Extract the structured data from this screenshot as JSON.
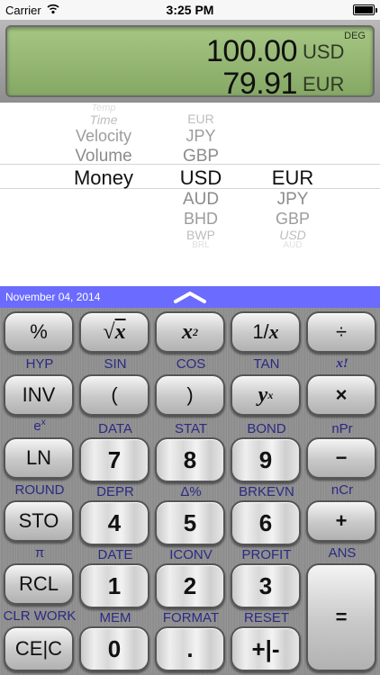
{
  "status_bar": {
    "carrier": "Carrier",
    "time": "3:25 PM"
  },
  "display": {
    "mode": "DEG",
    "line1_value": "100.00",
    "line1_currency": "USD",
    "line2_value": "79.91",
    "line2_currency": "EUR"
  },
  "picker": {
    "category": {
      "above": [
        "Temp",
        "Time",
        "Velocity",
        "Volume"
      ],
      "selected": "Money"
    },
    "from_currency": {
      "above": [
        "EUR",
        "JPY",
        "GBP"
      ],
      "selected": "USD",
      "below": [
        "AUD",
        "BHD",
        "BWP",
        "BRL"
      ]
    },
    "to_currency": {
      "selected": "EUR",
      "below": [
        "JPY",
        "GBP",
        "USD",
        "AUD"
      ]
    }
  },
  "date_bar": {
    "date": "November 04, 2014"
  },
  "keys": {
    "row1": [
      "%",
      "x",
      "x",
      "2",
      "1/",
      "x",
      "÷"
    ],
    "row1_labels": [
      "HYP",
      "SIN",
      "COS",
      "TAN",
      "x!"
    ],
    "row2": [
      "INV",
      "(",
      ")",
      "y",
      "x",
      "×"
    ],
    "row2_labels": [
      "e",
      "x",
      "DATA",
      "STAT",
      "BOND",
      "nPr"
    ],
    "row3": [
      "LN",
      "7",
      "8",
      "9",
      "−"
    ],
    "row3_labels": [
      "ROUND",
      "DEPR",
      "Δ%",
      "BRKEVN",
      "nCr"
    ],
    "row4": [
      "STO",
      "4",
      "5",
      "6",
      "+"
    ],
    "row4_labels": [
      "π",
      "DATE",
      "ICONV",
      "PROFIT",
      "ANS"
    ],
    "row5": [
      "RCL",
      "1",
      "2",
      "3",
      "="
    ],
    "row5_labels": [
      "CLR WORK",
      "MEM",
      "FORMAT",
      "RESET"
    ],
    "row6": [
      "CE|C",
      "0",
      ".",
      "+|-"
    ]
  }
}
